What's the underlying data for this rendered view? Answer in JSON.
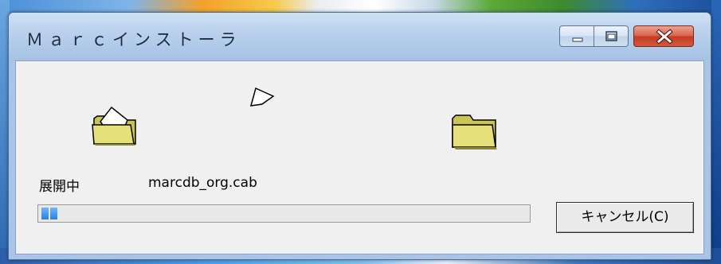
{
  "window": {
    "title": "Ｍａｒｃインストーラ",
    "controls": {
      "minimize": "minimize-icon",
      "maximize": "maximize-icon",
      "close": "close-icon"
    }
  },
  "content": {
    "status_label": "展開中",
    "file_name": "marcdb_org.cab",
    "progress_fraction": 0.04,
    "cancel_label": "キャンセル(C)"
  },
  "icons": {
    "source": "open-folder-icon",
    "destination": "folder-icon",
    "transfer": "flying-document-icon"
  },
  "colors": {
    "titlebar": "#b8d0ec",
    "close_button": "#c43c22",
    "progress": "#2a7fe0",
    "folder": "#e6e07a"
  }
}
